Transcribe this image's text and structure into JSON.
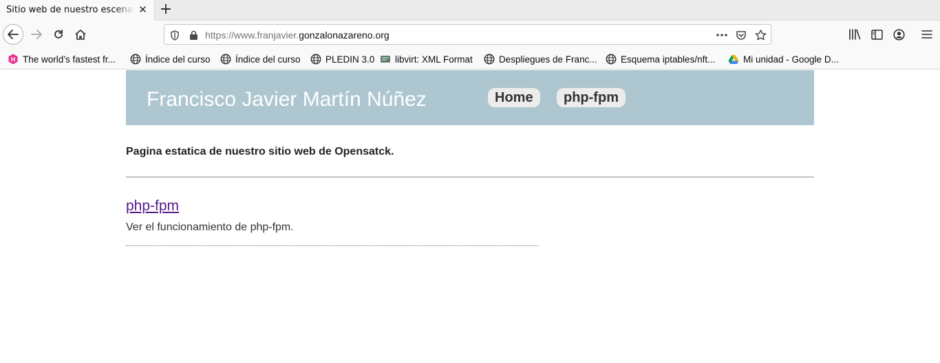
{
  "browser": {
    "tab": {
      "title": "Sitio web de nuestro escenario"
    },
    "url": {
      "prefix": "https://www.franjavier.",
      "domain": "gonzalonazareno.org"
    },
    "bookmarks": [
      {
        "label": "The world’s fastest fr...",
        "icon": "hasura-icon"
      },
      {
        "label": "Índice del curso",
        "icon": "globe-icon"
      },
      {
        "label": "Índice del curso",
        "icon": "globe-icon"
      },
      {
        "label": "PLEDIN 3.0",
        "icon": "globe-icon"
      },
      {
        "label": "libvirt: XML Format",
        "icon": "libvirt-icon"
      },
      {
        "label": "Despliegues de Franc...",
        "icon": "globe-icon"
      },
      {
        "label": "Esquema iptables/nft...",
        "icon": "globe-icon"
      },
      {
        "label": "Mi unidad - Google D...",
        "icon": "google-drive-icon"
      }
    ]
  },
  "page": {
    "site_title": "Francisco Javier Martín Núñez",
    "menu": [
      "Home",
      "php-fpm"
    ],
    "intro": "Pagina estatica de nuestro sitio web de Opensatck.",
    "post": {
      "title": "php-fpm",
      "description": "Ver el funcionamiento de php-fpm."
    }
  },
  "colors": {
    "header_bg": "#adc6d0",
    "link_visited": "#551a8b",
    "menu_bg": "#ececec"
  }
}
